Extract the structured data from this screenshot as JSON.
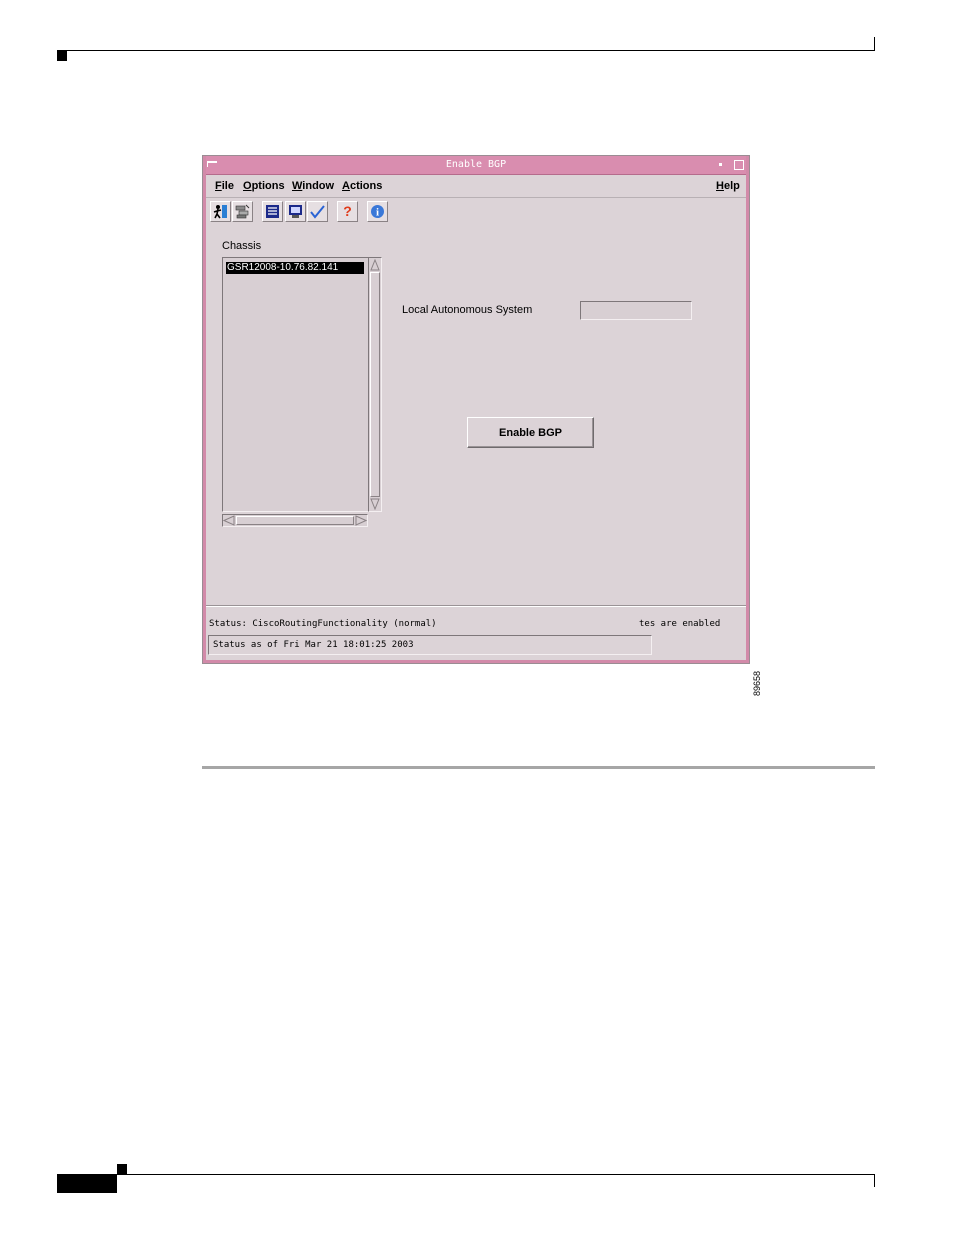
{
  "page": {
    "figure_number": "89658"
  },
  "window": {
    "title": "Enable BGP",
    "menu": {
      "file": "File",
      "options": "Options",
      "window": "Window",
      "actions": "Actions",
      "help": "Help"
    },
    "toolbar": {
      "icons": [
        "exit-icon",
        "network-icon",
        "list-icon",
        "monitor-icon",
        "checkmark-icon",
        "help-icon",
        "info-icon"
      ]
    },
    "chassis": {
      "label": "Chassis",
      "items": [
        "GSR12008-10.76.82.141"
      ]
    },
    "form": {
      "las_label": "Local Autonomous System",
      "las_value": ""
    },
    "enable_button": "Enable BGP",
    "status": {
      "line": "Status: CiscoRoutingFunctionality (normal)",
      "right": "tes are enabled",
      "box": "Status as of Fri Mar 21 18:01:25 2003"
    }
  }
}
